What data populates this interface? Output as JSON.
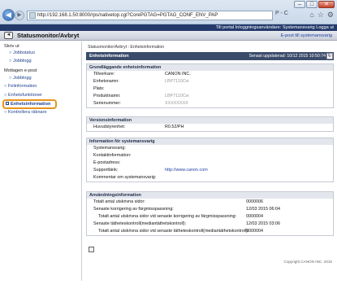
{
  "browser": {
    "url": "http://192.168.1.50:8000/rps/nativetop.cgi?CorePGTAG=PGTAG_CONF_ENV_PAP",
    "search": "P - C"
  },
  "header": {
    "links": "Till portal   Inloggningsanvändare: Systemansvarig Logga ut",
    "title": "Statusmonitor/Avbryt",
    "email_link": "E-post till systemansvarig"
  },
  "sidebar": {
    "heading_jobs": "Skriv ut",
    "jobstatus": "Jobbstatus",
    "jobblogg": "Jobblogg",
    "heading_email": "Mottagen e-post",
    "email_log": "Jobblogg",
    "errors": "Felinformation",
    "functions": "Enhetsfunktioner",
    "device_info": "Enhetsinformation",
    "counters": "Kontrollera räknare"
  },
  "main": {
    "breadcrumb": "Statusmonitor/Avbryt : Enhetsinformation",
    "page_title": "Enhetsinformation",
    "last_updated": "Senast uppdaterad: 10/12 2015 10:50:74",
    "sections": {
      "basic": {
        "title": "Grundläggande enhetsinformation",
        "rows": [
          {
            "label": "Tillverkare:",
            "value": "CANON INC."
          },
          {
            "label": "Enhetsnamn:",
            "value": "LBP7110Cw"
          },
          {
            "label": "Plats:",
            "value": ""
          },
          {
            "label": "Produktnamn:",
            "value": "LBP7110Cw"
          },
          {
            "label": "Serienummer:",
            "value": "XXXXXXXX"
          }
        ]
      },
      "version": {
        "title": "Versionsinformation",
        "rows": [
          {
            "label": "Huvudstyrenhet:",
            "value": "R0.52/PH"
          }
        ]
      },
      "admin": {
        "title": "Information för systemansvarig",
        "rows": [
          {
            "label": "Systemansvarig:",
            "value": ""
          },
          {
            "label": "Kontaktinformation:",
            "value": ""
          },
          {
            "label": "E-postadress:",
            "value": ""
          },
          {
            "label": "Supportlänk:",
            "value": "http://www.canon.com"
          },
          {
            "label": "Kommentar om systemansvarig:",
            "value": ""
          }
        ]
      },
      "usage": {
        "title": "Användningsinformation",
        "rows": [
          {
            "label": "Totalt antal utskrivna sidor:",
            "value": "0000006",
            "indent": false
          },
          {
            "label": "Senaste korrigering av färgmisspassning:",
            "value": "12/03 2015 06:04",
            "indent": false
          },
          {
            "label": "Totalt antal utskrivna sidor vid senaste korrigering av färgmisspassning:",
            "value": "0000004",
            "indent": true
          },
          {
            "label": "Senaste tätheteskontroll(mediantäthetskontroll):",
            "value": "12/03 2015 03:06",
            "indent": false
          },
          {
            "label": "Totalt antal utskrivna sidor vid senaste tätheteskontroll(mediantäthetskontroll):",
            "value": "0000004",
            "indent": true
          }
        ]
      }
    },
    "copyright": "Copyright CANON INC. 2015"
  }
}
